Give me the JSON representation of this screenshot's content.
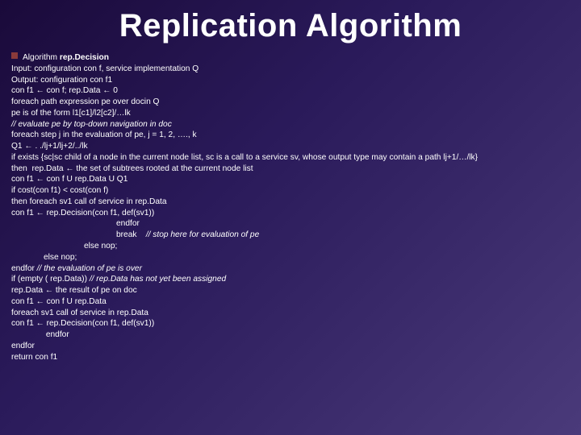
{
  "title": "Replication Algorithm",
  "lines": [
    {
      "cls": "i1",
      "html": "Algorithm <b>rep.Decision</b>"
    },
    {
      "cls": "i1",
      "html": "Input: configuration con f, service implementation Q"
    },
    {
      "cls": "i1",
      "html": "Output: configuration con f1"
    },
    {
      "cls": "i1",
      "html": "con f1 ← con f; rep.Data ← 0"
    },
    {
      "cls": "i1",
      "html": "foreach path expression pe over docin Q"
    },
    {
      "cls": "i1",
      "html": "pe is of the form l1[c1]/l2[c2]/…lk"
    },
    {
      "cls": "i1",
      "html": "<i>// evaluate pe by top-down navigation in doc</i>"
    },
    {
      "cls": "i1",
      "html": "foreach step j in the evaluation of pe, j = 1, 2, …., k"
    },
    {
      "cls": "i1",
      "html": "Q1 ← . ./lj+1/lj+2/../lk"
    },
    {
      "cls": "i1",
      "html": "if exists {sc|sc child of a node in the current node list, sc is a call to a service sv, whose output type may contain a path lj+1/…/lk}"
    },
    {
      "cls": "i1",
      "html": "then  rep.Data ← the set of subtrees rooted at the current node list"
    },
    {
      "cls": "i1",
      "html": "con f1 ← con f U rep.Data U Q1"
    },
    {
      "cls": "i1",
      "html": "if cost(con f1) &lt; cost(con f)"
    },
    {
      "cls": "i1",
      "html": "then foreach sv1 call of service in rep.Data"
    },
    {
      "cls": "i1",
      "html": "con f1 ← rep.Decision(con f1, def(sv1))"
    },
    {
      "cls": "i4",
      "html": "endfor"
    },
    {
      "cls": "i4",
      "html": "break    <i>// stop here for evaluation of pe</i>"
    },
    {
      "cls": "i3",
      "html": "else nop;"
    },
    {
      "cls": "i2",
      "html": "else nop;"
    },
    {
      "cls": "i1",
      "html": "endfor <i>// the evaluation of pe is over</i>"
    },
    {
      "cls": "i1",
      "html": "if (empty ( rep.Data)) <i>// rep.Data has not yet been assigned</i>"
    },
    {
      "cls": "i1",
      "html": "rep.Data ← the result of pe on doc"
    },
    {
      "cls": "i1",
      "html": "con f1 ← con f U rep.Data"
    },
    {
      "cls": "i1",
      "html": "foreach sv1 call of service in rep.Data"
    },
    {
      "cls": "i1",
      "html": "con f1 ← rep.Decision(con f1, def(sv1))"
    },
    {
      "cls": "i2",
      "html": " endfor"
    },
    {
      "cls": "i1",
      "html": "endfor"
    },
    {
      "cls": "i1",
      "html": "return con f1"
    }
  ]
}
